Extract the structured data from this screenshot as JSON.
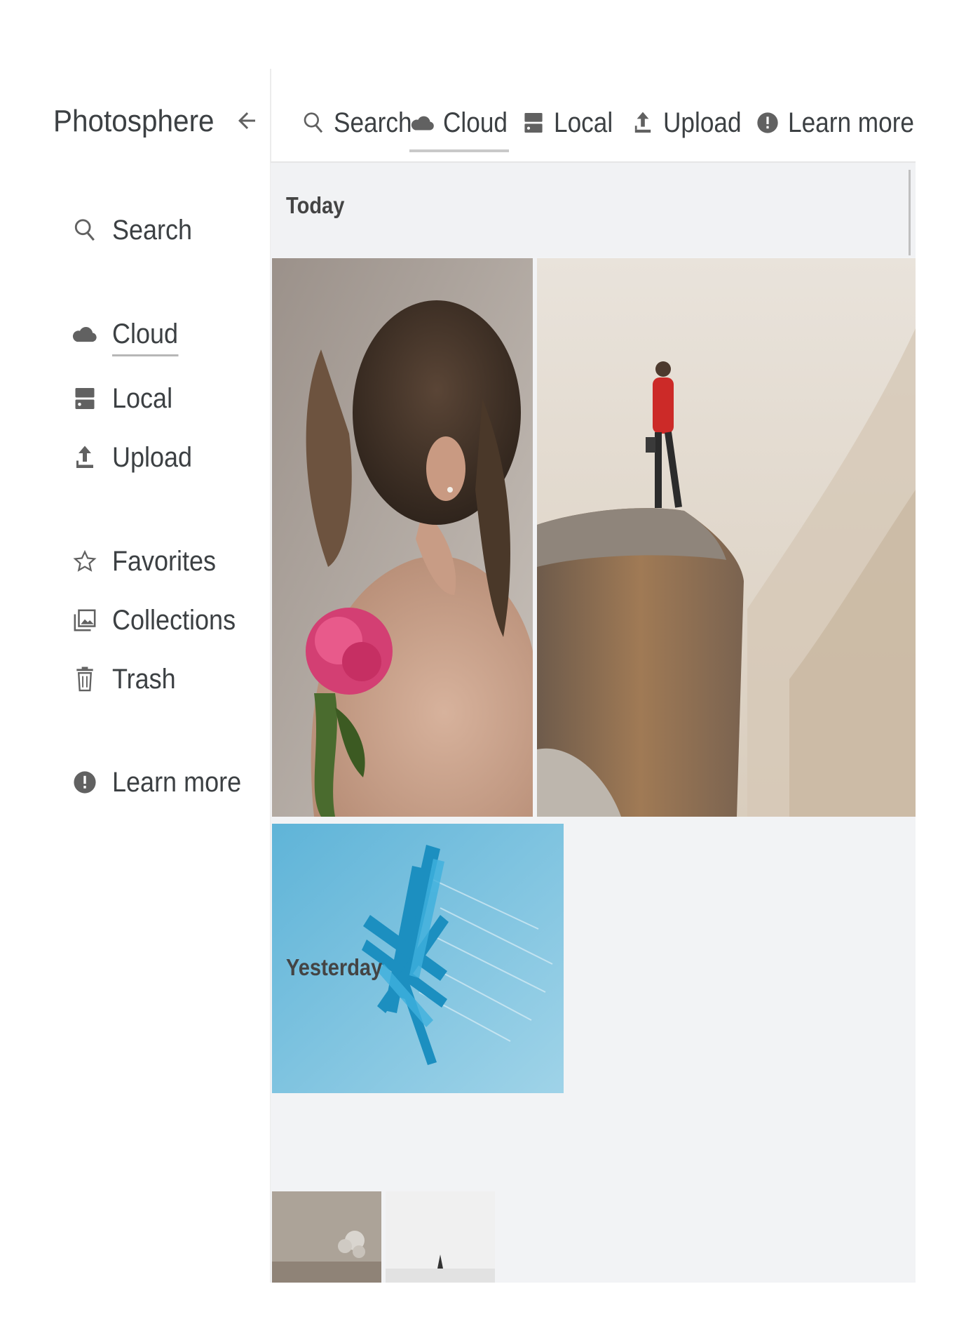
{
  "app": {
    "title": "Photosphere"
  },
  "sidebar": {
    "items": [
      {
        "label": "Search",
        "icon": "search-icon"
      },
      {
        "label": "Cloud",
        "icon": "cloud-icon",
        "active": true
      },
      {
        "label": "Local",
        "icon": "storage-icon"
      },
      {
        "label": "Upload",
        "icon": "upload-icon"
      },
      {
        "label": "Favorites",
        "icon": "star-icon"
      },
      {
        "label": "Collections",
        "icon": "collections-icon"
      },
      {
        "label": "Trash",
        "icon": "trash-icon"
      },
      {
        "label": "Learn more",
        "icon": "info-icon"
      }
    ]
  },
  "topbar": {
    "tabs": [
      {
        "label": "Search",
        "icon": "search-icon"
      },
      {
        "label": "Cloud",
        "icon": "cloud-icon",
        "active": true
      },
      {
        "label": "Local",
        "icon": "storage-icon"
      },
      {
        "label": "Upload",
        "icon": "upload-icon"
      },
      {
        "label": "Learn more",
        "icon": "info-icon"
      }
    ]
  },
  "gallery": {
    "sections": [
      {
        "label": "Today",
        "photos": [
          "woman-with-peony",
          "hiker-on-cliff",
          "blue-abstract-splash"
        ]
      },
      {
        "label": "Yesterday",
        "photos": [
          "gray-flowers",
          "white-peak"
        ]
      }
    ]
  },
  "colors": {
    "icon": "#616161",
    "content_bg": "#f2f3f5",
    "active_underline": "#c9c9c9"
  }
}
